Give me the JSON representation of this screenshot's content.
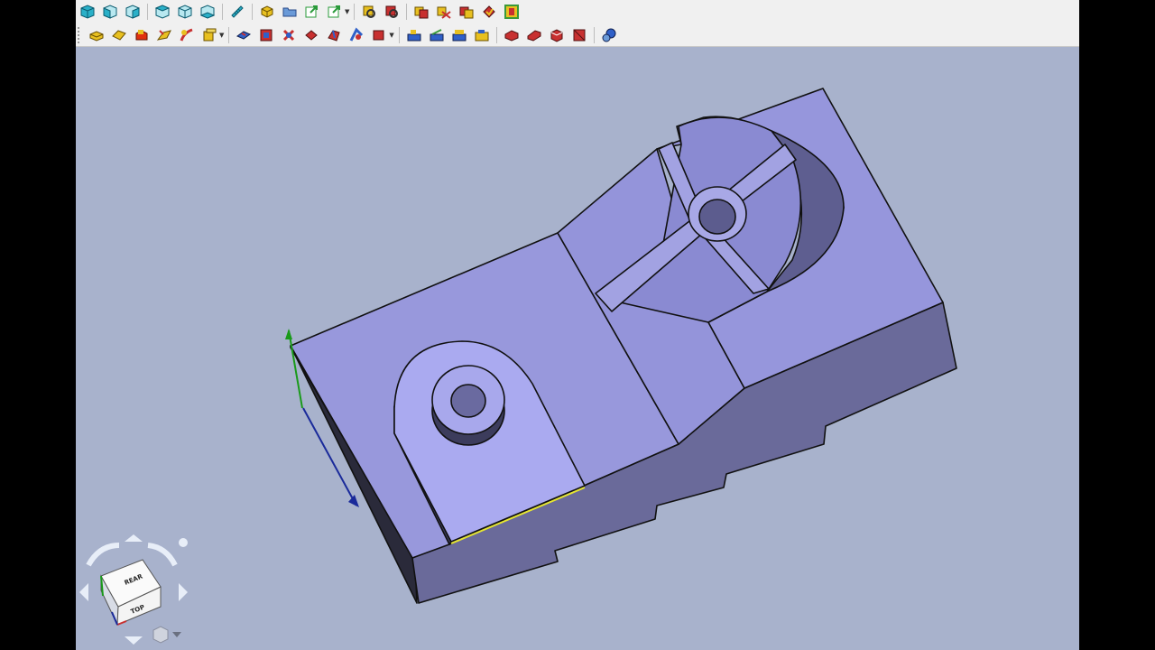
{
  "window": {
    "title": ""
  },
  "toolbar_row1": {
    "buttons": [
      {
        "name": "view-isometric",
        "icon": "cube-isometric-icon",
        "color": "#2ab0c8"
      },
      {
        "name": "view-front",
        "icon": "cube-front-icon",
        "color": "#2ab0c8"
      },
      {
        "name": "view-top",
        "icon": "cube-top-icon",
        "color": "#2ab0c8"
      },
      {
        "name": "view-right",
        "icon": "cube-right-icon",
        "color": "#2ab0c8"
      },
      {
        "name": "view-rear",
        "icon": "cube-rear-icon",
        "color": "#2ab0c8"
      },
      {
        "name": "view-bottom",
        "icon": "cube-bottom-icon",
        "color": "#2ab0c8"
      },
      {
        "name": "measure",
        "icon": "ruler-icon",
        "color": "#2ab0c8"
      },
      {
        "name": "create-part",
        "icon": "part-icon",
        "color": "#e8c020"
      },
      {
        "name": "create-group",
        "icon": "folder-icon",
        "color": "#4a7ec8"
      },
      {
        "name": "link",
        "icon": "link-arrow-icon",
        "color": "#2a9a3a"
      },
      {
        "name": "link-actions",
        "icon": "link-dropdown-icon",
        "color": "#2a9a3a"
      },
      {
        "name": "tool-a",
        "icon": "magnifier-part-icon",
        "color": "#c8a020"
      },
      {
        "name": "tool-b",
        "icon": "magnifier-red-icon",
        "color": "#c83030"
      },
      {
        "name": "tool-c",
        "icon": "check-part-icon",
        "color": "#c83030"
      },
      {
        "name": "tool-d",
        "icon": "check-part-icon",
        "color": "#c83030"
      },
      {
        "name": "tool-e",
        "icon": "check-part-icon",
        "color": "#c83030"
      },
      {
        "name": "tool-f",
        "icon": "check-part-icon",
        "color": "#c83030"
      },
      {
        "name": "tool-g",
        "icon": "green-frame-icon",
        "color": "#3a9a3a"
      }
    ]
  },
  "toolbar_row2": {
    "buttons": [
      {
        "name": "extrude",
        "icon": "extrude-icon",
        "color": "#e8c020"
      },
      {
        "name": "revolve",
        "icon": "revolve-icon",
        "color": "#e8c020"
      },
      {
        "name": "mirror",
        "icon": "mirror-icon",
        "color": "#e03010"
      },
      {
        "name": "fillet",
        "icon": "fillet-icon",
        "color": "#e8c020"
      },
      {
        "name": "sweep",
        "icon": "sweep-icon",
        "color": "#e8c020"
      },
      {
        "name": "loft",
        "icon": "loft-icon",
        "color": "#e8c020"
      },
      {
        "name": "compound",
        "icon": "compound-icon",
        "color": "#c83030"
      },
      {
        "name": "shape-builder",
        "icon": "shape-builder-icon",
        "color": "#3060c8"
      },
      {
        "name": "boolean",
        "icon": "boolean-icon",
        "color": "#c83030"
      },
      {
        "name": "cut",
        "icon": "cut-icon",
        "color": "#c83030"
      },
      {
        "name": "fuse",
        "icon": "fuse-icon",
        "color": "#c83030"
      },
      {
        "name": "common",
        "icon": "common-icon",
        "color": "#c83030"
      },
      {
        "name": "section",
        "icon": "section-icon",
        "color": "#c83030"
      },
      {
        "name": "measure-linear",
        "icon": "measure-linear-icon",
        "color": "#3a9a3a"
      },
      {
        "name": "measure-angular",
        "icon": "measure-angular-icon",
        "color": "#3a9a3a"
      },
      {
        "name": "measure-refresh",
        "icon": "measure-refresh-icon",
        "color": "#3a9a3a"
      },
      {
        "name": "measure-clear",
        "icon": "measure-clear-icon",
        "color": "#3a9a3a"
      },
      {
        "name": "chamfer",
        "icon": "chamfer-icon",
        "color": "#c83030"
      },
      {
        "name": "offset",
        "icon": "offset-icon",
        "color": "#c83030"
      },
      {
        "name": "thickness",
        "icon": "thickness-icon",
        "color": "#c83030"
      },
      {
        "name": "projection",
        "icon": "projection-icon",
        "color": "#c83030"
      },
      {
        "name": "attach",
        "icon": "attach-icon",
        "color": "#3060c8"
      }
    ]
  },
  "viewport": {
    "background": "#a8b2cc",
    "model": {
      "top_face": "#9696dc",
      "front_face": "#6a6a9a",
      "dark_face": "#2a2a3a",
      "highlight": "#e6e632"
    }
  },
  "navigation_cube": {
    "face_top": "REAR",
    "face_front": "TOP"
  }
}
